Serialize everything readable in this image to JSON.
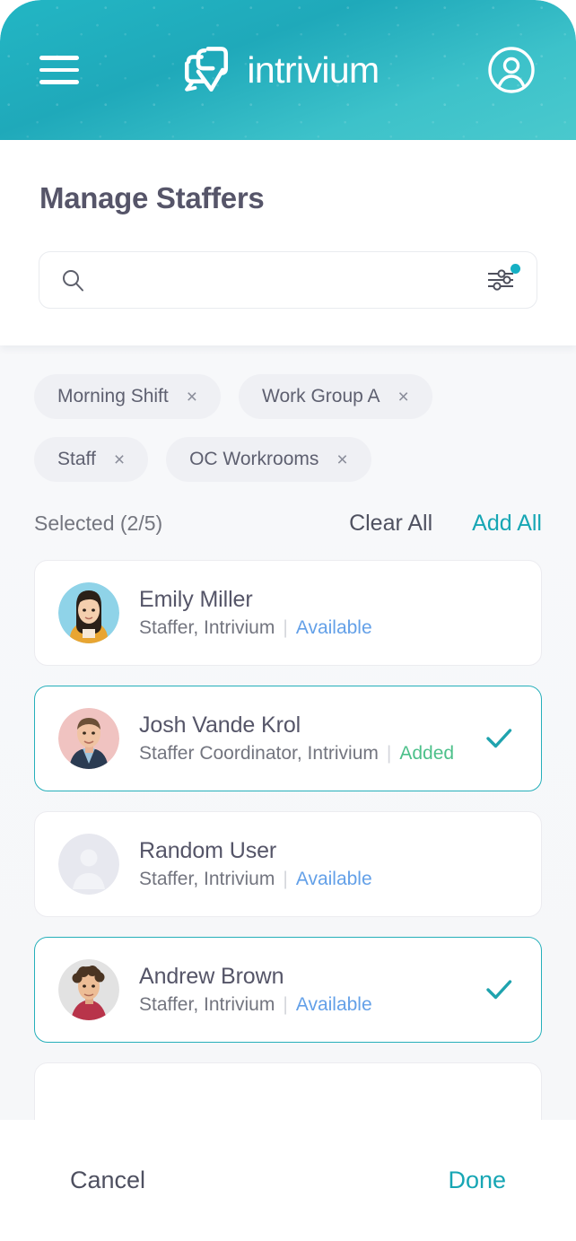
{
  "header": {
    "menu_icon": "hamburger-menu-icon",
    "brand_name": "intrivium",
    "logo_icon": "intrivium-logo-mark",
    "profile_icon": "user-circle-icon"
  },
  "page": {
    "title": "Manage Staffers"
  },
  "search": {
    "value": "",
    "placeholder": "",
    "search_icon": "search-icon",
    "filter_icon": "filter-sliders-icon",
    "filter_badge_visible": true,
    "filter_badge_color": "#16b0c4"
  },
  "filters": {
    "chips": [
      {
        "label": "Morning Shift",
        "remove": "×"
      },
      {
        "label": "Work Group A",
        "remove": "×"
      },
      {
        "label": "Staff",
        "remove": "×"
      },
      {
        "label": "OC Workrooms",
        "remove": "×"
      }
    ]
  },
  "selection": {
    "label": "Selected (2/5)",
    "selected_count": 2,
    "total_count": 5,
    "clear_all_label": "Clear All",
    "add_all_label": "Add All"
  },
  "staffers": [
    {
      "name": "Emily Miller",
      "role": "Staffer, Intrivium",
      "separator": "|",
      "status": "Available",
      "status_type": "available",
      "selected": false,
      "avatar_type": "photo",
      "avatar_bg": "#8fd3e8"
    },
    {
      "name": "Josh Vande Krol",
      "role": "Staffer Coordinator, Intrivium",
      "separator": "|",
      "status": "Added",
      "status_type": "added",
      "selected": true,
      "avatar_type": "photo",
      "avatar_bg": "#f0c3c1"
    },
    {
      "name": "Random User",
      "role": "Staffer, Intrivium",
      "separator": "|",
      "status": "Available",
      "status_type": "available",
      "selected": false,
      "avatar_type": "placeholder",
      "avatar_bg": "#e7e8ef"
    },
    {
      "name": "Andrew Brown",
      "role": "Staffer, Intrivium",
      "separator": "|",
      "status": "Available",
      "status_type": "available",
      "selected": true,
      "avatar_type": "photo",
      "avatar_bg": "#e2e2e2"
    }
  ],
  "footer": {
    "cancel_label": "Cancel",
    "done_label": "Done"
  },
  "colors": {
    "accent_teal": "#17a6b4",
    "header_gradient_start": "#23b6c4",
    "header_gradient_end": "#4ac9cd",
    "title_text": "#565569",
    "status_available": "#63a0e8",
    "status_added": "#4cc08a"
  }
}
